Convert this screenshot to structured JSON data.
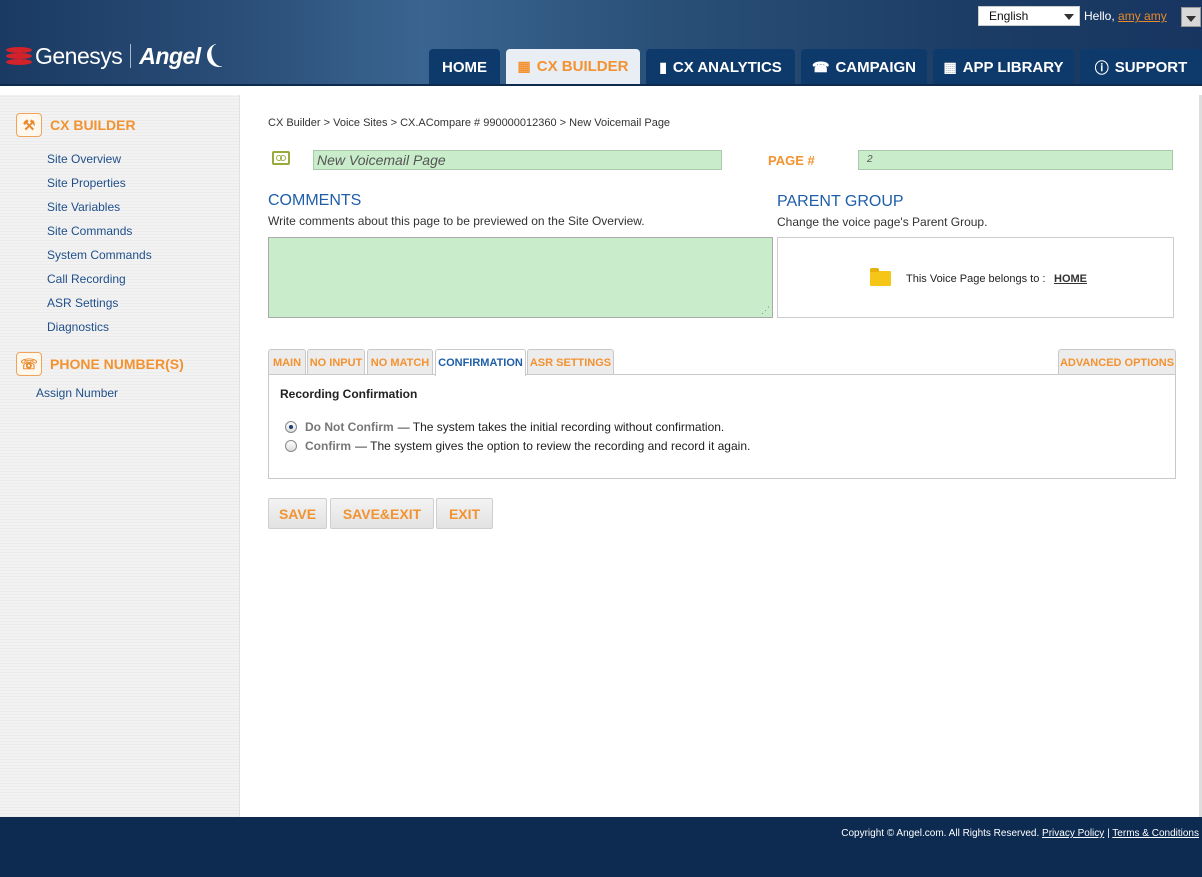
{
  "header": {
    "brand": "Genesys",
    "product": "Angel",
    "language": "English",
    "greeting": "Hello,",
    "user": "amy amy",
    "tabs": [
      {
        "label": "HOME",
        "icon": ""
      },
      {
        "label": "CX BUILDER",
        "icon": "cx-builder-icon"
      },
      {
        "label": "CX ANALYTICS",
        "icon": "bar-chart-icon"
      },
      {
        "label": "CAMPAIGN",
        "icon": "campaign-icon"
      },
      {
        "label": "APP LIBRARY",
        "icon": "grid-icon"
      },
      {
        "label": "SUPPORT",
        "icon": "info-icon"
      }
    ]
  },
  "sidebar": {
    "cx_builder": {
      "title": "CX BUILDER",
      "items": [
        "Site Overview",
        "Site Properties",
        "Site Variables",
        "Site Commands",
        "System Commands",
        "Call Recording",
        "ASR Settings",
        "Diagnostics"
      ]
    },
    "phone_numbers": {
      "title": "PHONE NUMBER(S)",
      "items": [
        "Assign Number"
      ]
    }
  },
  "main": {
    "breadcrumb": "CX Builder > Voice Sites > CX.ACompare # 990000012360 > New Voicemail Page",
    "page_name": "New Voicemail Page",
    "page_num_label": "PAGE #",
    "page_num": "2",
    "comments": {
      "title": "COMMENTS",
      "desc": "Write comments about this page to be previewed on the Site Overview.",
      "value": ""
    },
    "parent_group": {
      "title": "PARENT GROUP",
      "desc": "Change the voice page's Parent Group.",
      "text": "This Voice Page belongs to :",
      "link": "HOME"
    },
    "tabs": [
      "MAIN",
      "NO INPUT",
      "NO MATCH",
      "CONFIRMATION",
      "ASR SETTINGS"
    ],
    "advanced": "ADVANCED OPTIONS",
    "panel": {
      "title": "Recording Confirmation",
      "options": [
        {
          "label": "Do Not Confirm",
          "desc": "— The system takes the initial recording without confirmation.",
          "checked": true
        },
        {
          "label": "Confirm",
          "desc": "— The system gives the option to review the recording and record it again.",
          "checked": false
        }
      ]
    },
    "buttons": {
      "save": "SAVE",
      "save_exit": "SAVE&EXIT",
      "exit": "EXIT"
    }
  },
  "footer": {
    "copyright": "Copyright © Angel.com. All Rights Reserved.",
    "privacy": "Privacy Policy",
    "sep": "|",
    "terms": "Terms & Conditions"
  }
}
